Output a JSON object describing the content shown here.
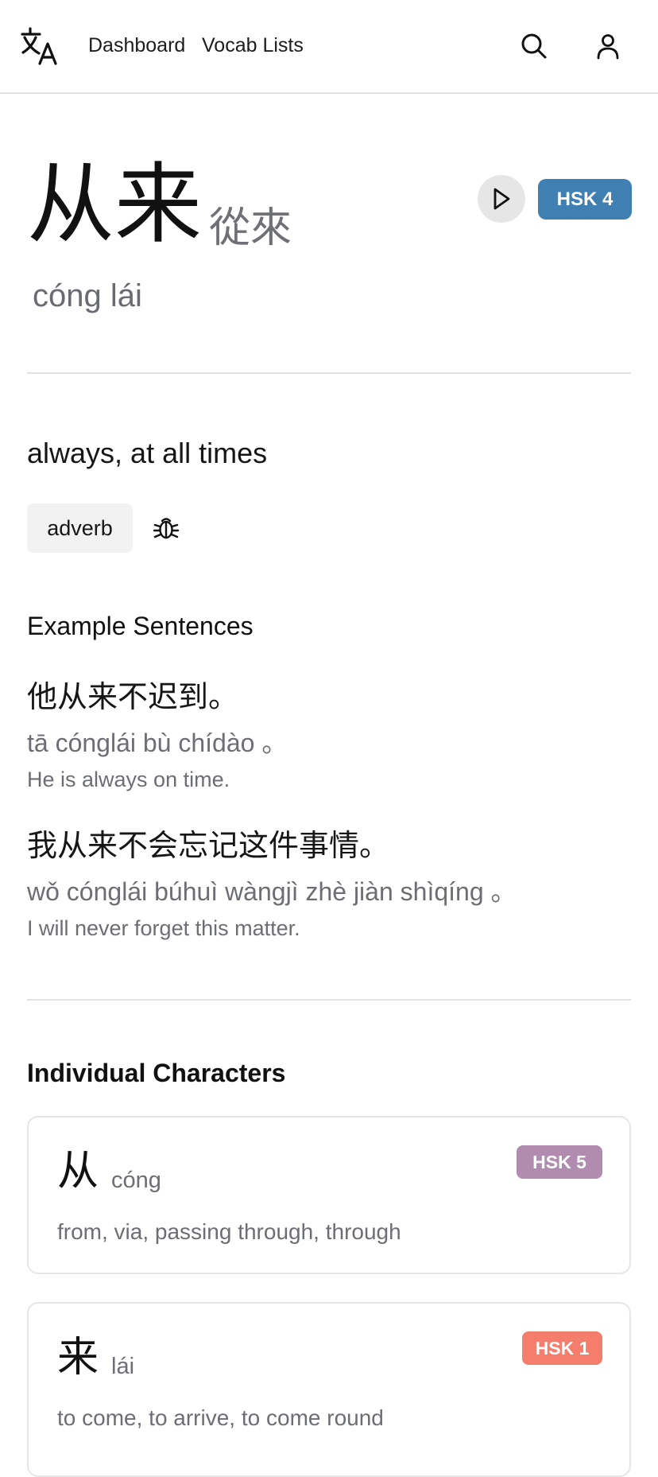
{
  "header": {
    "logo_icon": "translate-icon",
    "nav": [
      "Dashboard",
      "Vocab Lists"
    ],
    "search_icon": "search-icon",
    "user_icon": "user-icon"
  },
  "word": {
    "simplified": "从来",
    "traditional": "從來",
    "pinyin": "cóng lái",
    "hsk": "HSK 4",
    "hsk_color": "#3f7fb2",
    "meaning": "always, at all times",
    "part_of_speech": "adverb"
  },
  "examples": {
    "title": "Example Sentences",
    "items": [
      {
        "hanzi": "他从来不迟到。",
        "pinyin": "tā cónglái bù chídào 。",
        "english": "He is always on time."
      },
      {
        "hanzi": "我从来不会忘记这件事情。",
        "pinyin": "wǒ cónglái búhuì wàngjì zhè jiàn shìqíng 。",
        "english": "I will never forget this matter."
      }
    ]
  },
  "characters": {
    "title": "Individual Characters",
    "items": [
      {
        "hanzi": "从",
        "pinyin": "cóng",
        "definition": "from, via, passing through, through",
        "hsk": "HSK 5",
        "hsk_color": "#b28cb0"
      },
      {
        "hanzi": "来",
        "pinyin": "lái",
        "definition": "to come, to arrive, to come round",
        "hsk": "HSK 1",
        "hsk_color": "#f47d6c"
      }
    ]
  }
}
